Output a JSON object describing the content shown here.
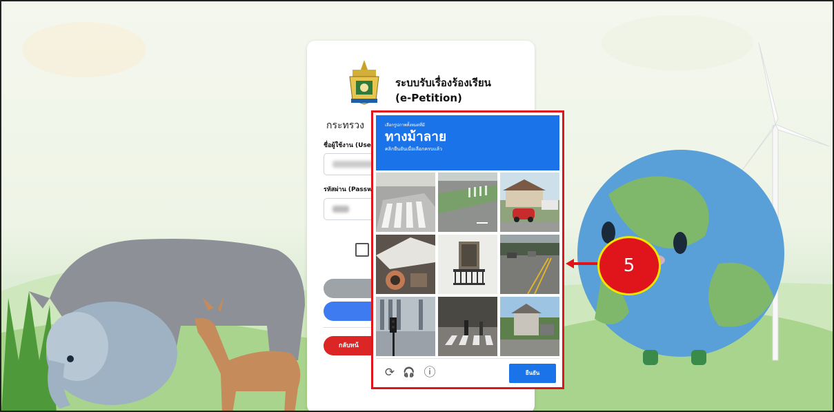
{
  "login": {
    "system_title_line1": "ระบบรับเรื่องร้องเรียน",
    "system_title_line2": "(e-Petition)",
    "ministry": "กระทรวง",
    "username_label": "ชื่อผู้ใช้งาน (Userm",
    "password_label": "รหัสผ่าน (Passwo",
    "back_button": "กลับหน้"
  },
  "captcha": {
    "instruction_small": "เลือกรูปภาพทั้งหมดที่มี",
    "target_object": "ทางม้าลาย",
    "instruction_sub": "คลิกยืนยันเมื่อเลือกครบแล้ว",
    "tiles": [
      "tile-1",
      "tile-2",
      "tile-3",
      "tile-4",
      "tile-5",
      "tile-6",
      "tile-7",
      "tile-8",
      "tile-9"
    ],
    "reload_icon": "⟳",
    "audio_icon": "🎧",
    "info_icon": "ⓘ",
    "verify_button": "ยืนยัน"
  },
  "annotation": {
    "step_number": "5",
    "color": "#e0151b",
    "border_color": "#f5e400"
  }
}
